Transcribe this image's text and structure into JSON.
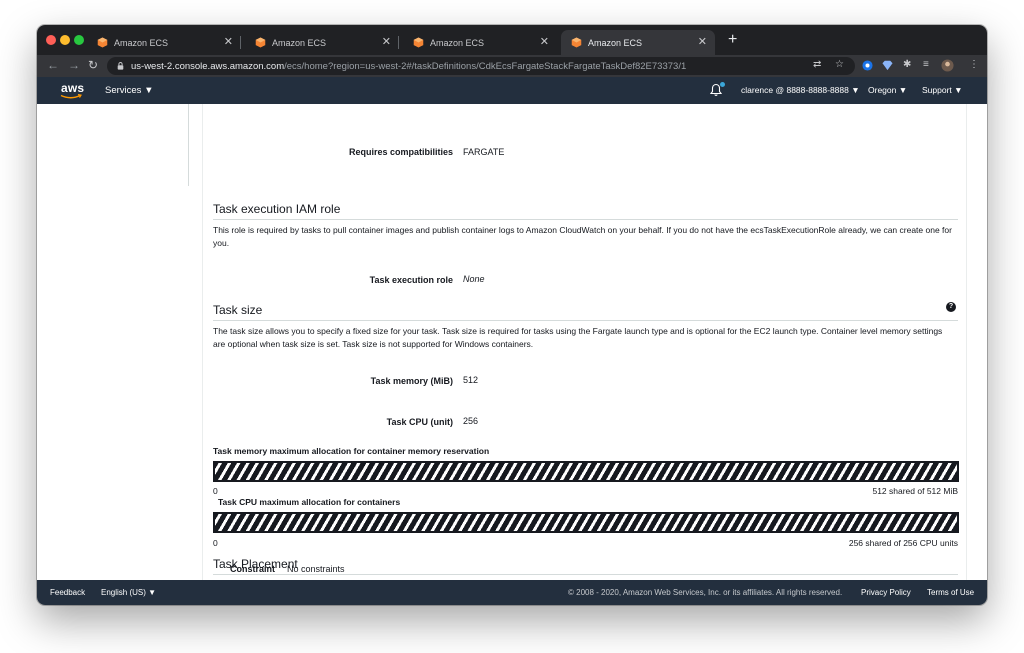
{
  "browser": {
    "tabs": [
      {
        "title": "Amazon ECS",
        "active": false
      },
      {
        "title": "Amazon ECS",
        "active": false
      },
      {
        "title": "Amazon ECS",
        "active": false
      },
      {
        "title": "Amazon ECS",
        "active": true
      }
    ],
    "new_tab": "+",
    "url_host": "us-west-2.console.aws.amazon.com",
    "url_path": "/ecs/home?region=us-west-2#/taskDefinitions/CdkEcsFargateStackFargateTaskDef82E73373/1"
  },
  "aws_nav": {
    "logo": "aws",
    "services": "Services ▼",
    "account": "clarence @ 8888-8888-8888 ▼",
    "region": "Oregon ▼",
    "support": "Support ▼"
  },
  "details": {
    "requires_compat_label": "Requires compatibilities",
    "requires_compat_value": "FARGATE"
  },
  "iam_section": {
    "title": "Task execution IAM role",
    "description": "This role is required by tasks to pull container images and publish container logs to Amazon CloudWatch on your behalf. If you do not have the ecsTaskExecutionRole already, we can create one for you.",
    "role_label": "Task execution role",
    "role_value": "None"
  },
  "task_size": {
    "title": "Task size",
    "help": "?",
    "description": "The task size allows you to specify a fixed size for your task. Task size is required for tasks using the Fargate launch type and is optional for the EC2 launch type. Container level memory settings are optional when task size is set. Task size is not supported for Windows containers.",
    "memory_label": "Task memory (MiB)",
    "memory_value": "512",
    "cpu_label": "Task CPU (unit)",
    "cpu_value": "256"
  },
  "allocations": {
    "memory": {
      "title": "Task memory maximum allocation for container memory reservation",
      "min": "0",
      "max": "512 shared of 512 MiB",
      "fill_fraction": 1.0
    },
    "cpu": {
      "title": "Task CPU maximum allocation for containers",
      "min": "0",
      "max": "256 shared of 256 CPU units",
      "fill_fraction": 1.0
    }
  },
  "placement": {
    "title": "Task Placement",
    "constraint_label": "Constraint",
    "constraint_value": "No constraints"
  },
  "footer": {
    "feedback": "Feedback",
    "language": "English (US) ▼",
    "copyright": "© 2008 - 2020, Amazon Web Services, Inc. or its affiliates. All rights reserved.",
    "privacy": "Privacy Policy",
    "terms": "Terms of Use"
  },
  "colors": {
    "aws_nav_bg": "#232f3e",
    "aws_orange": "#ff9900",
    "chrome_tab_bg": "#202124",
    "chrome_active_tab": "#35363a"
  }
}
